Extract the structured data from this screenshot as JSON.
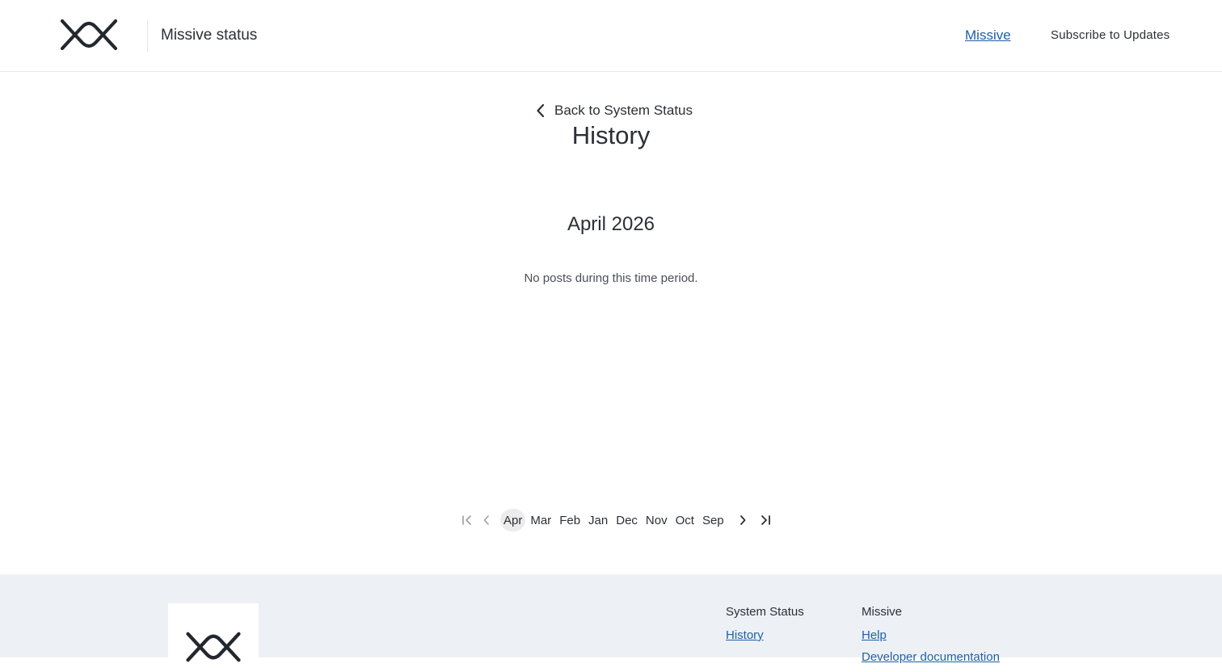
{
  "header": {
    "brand_title": "Missive status",
    "nav_link": "Missive",
    "subscribe_label": "Subscribe to Updates",
    "logo_icon": "missive-logo-icon"
  },
  "main": {
    "back_label": "Back to System Status",
    "back_icon": "chevron-left-icon",
    "page_title": "History",
    "month_title": "April 2026",
    "empty_message": "No posts during this time period."
  },
  "pagination": {
    "icons": [
      "first-page-icon",
      "previous-page-icon",
      "next-page-icon",
      "last-page-icon"
    ],
    "months": [
      {
        "label": "Apr",
        "active": true
      },
      {
        "label": "Mar",
        "active": false
      },
      {
        "label": "Feb",
        "active": false
      },
      {
        "label": "Jan",
        "active": false
      },
      {
        "label": "Dec",
        "active": false
      },
      {
        "label": "Nov",
        "active": false
      },
      {
        "label": "Oct",
        "active": false
      },
      {
        "label": "Sep",
        "active": false
      }
    ]
  },
  "footer": {
    "columns": [
      {
        "heading": "System Status",
        "links": [
          "History"
        ]
      },
      {
        "heading": "Missive",
        "links": [
          "Help",
          "Developer documentation"
        ]
      }
    ]
  },
  "colors": {
    "link": "#1f5fa8",
    "text": "#2b2f36",
    "footer_bg": "#edf1f6",
    "active_month_bg": "#ececec"
  }
}
